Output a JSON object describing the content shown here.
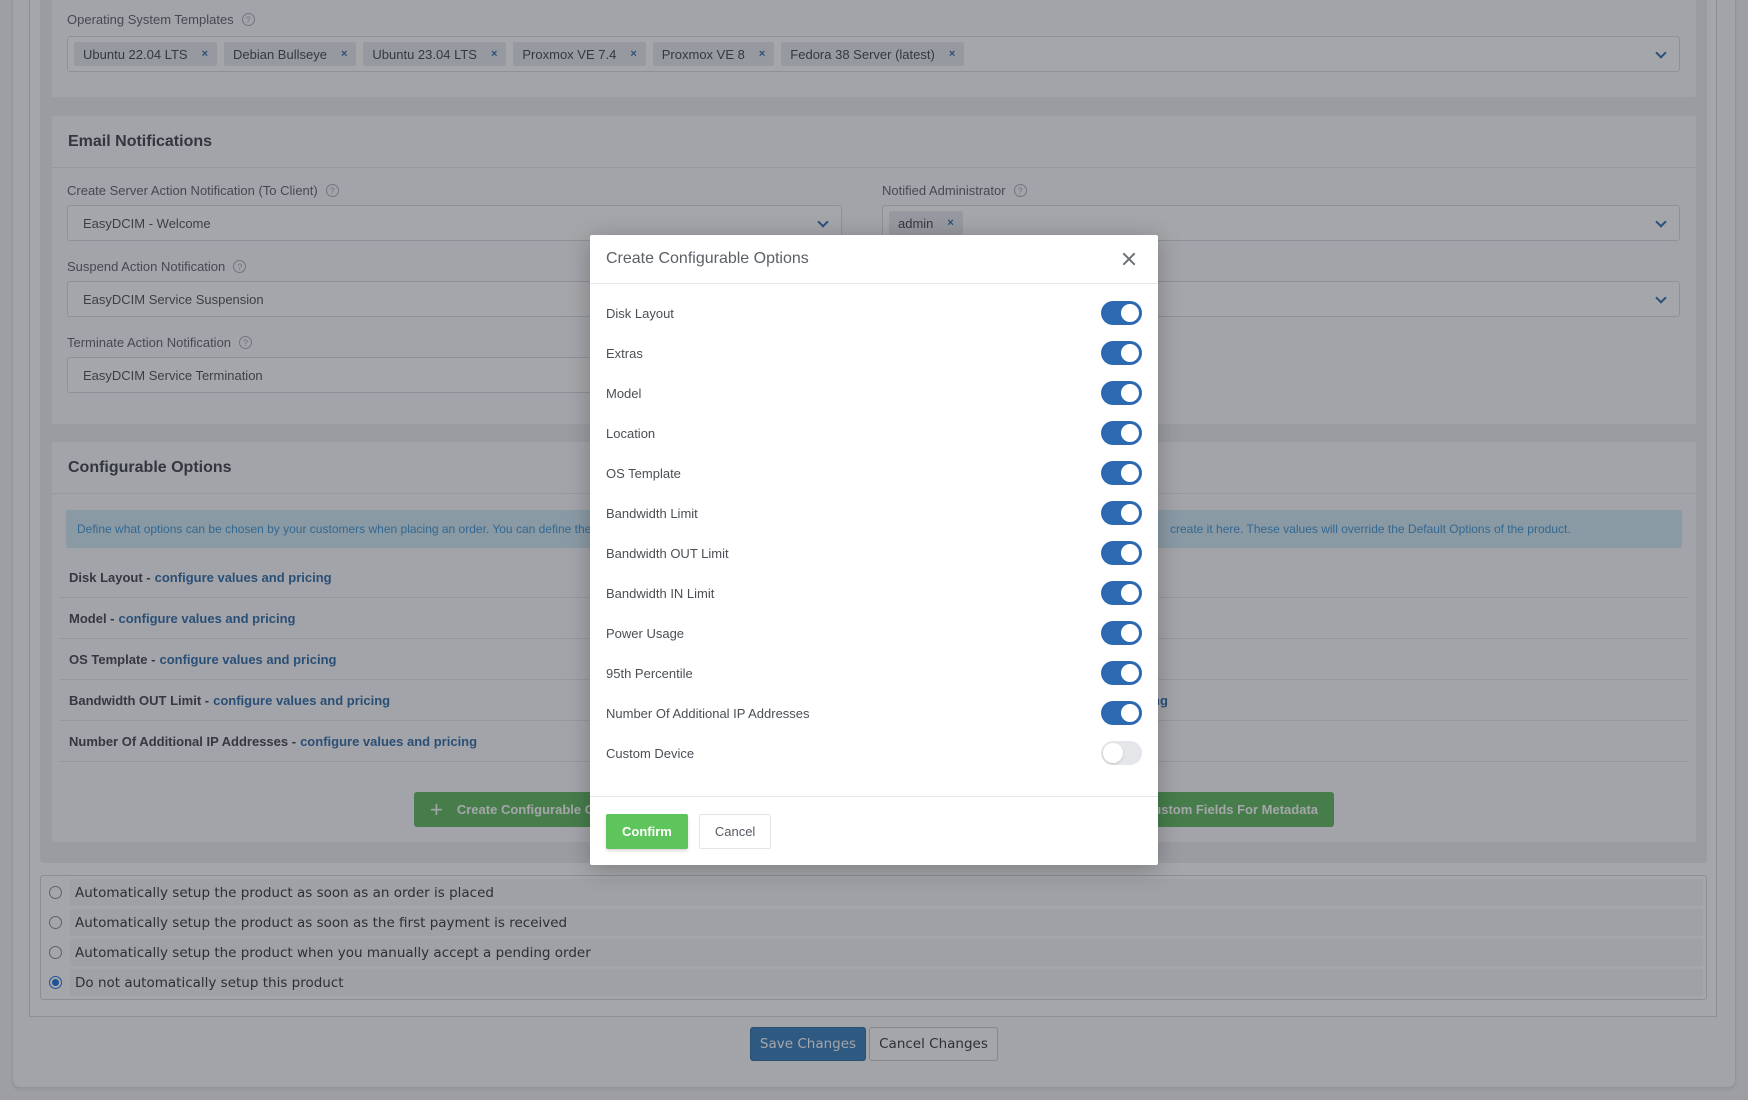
{
  "os_templates": {
    "label": "Operating System Templates",
    "tags": [
      "Ubuntu 22.04 LTS",
      "Debian Bullseye",
      "Ubuntu 23.04 LTS",
      "Proxmox VE 7.4",
      "Proxmox VE 8",
      "Fedora 38 Server (latest)"
    ]
  },
  "email_notifications": {
    "title": "Email Notifications",
    "create_label": "Create Server Action Notification (To Client)",
    "create_value": "EasyDCIM - Welcome",
    "suspend_label": "Suspend Action Notification",
    "suspend_value": "EasyDCIM Service Suspension",
    "terminate_label": "Terminate Action Notification",
    "terminate_value": "EasyDCIM Service Termination",
    "admin_label": "Notified Administrator",
    "admin_tags": [
      "admin"
    ]
  },
  "configurable_options": {
    "title": "Configurable Options",
    "info": "Define what options can be chosen by your customers when placing an order. You can define the",
    "info_tail": "create it here. These values will override the Default Options of the product.",
    "link_text": "configure values and pricing",
    "items": [
      "Disk Layout",
      "Model",
      "OS Template",
      "Bandwidth OUT Limit",
      "Number Of Additional IP Addresses"
    ],
    "right_partial": "ng",
    "create_button": "Create Configurable Options",
    "metadata_button": "Create Custom Fields For Metadata"
  },
  "setup": {
    "options": [
      {
        "label": "Automatically setup the product as soon as an order is placed",
        "checked": false
      },
      {
        "label": "Automatically setup the product as soon as the first payment is received",
        "checked": false
      },
      {
        "label": "Automatically setup the product when you manually accept a pending order",
        "checked": false
      },
      {
        "label": "Do not automatically setup this product",
        "checked": true
      }
    ]
  },
  "actions": {
    "save": "Save Changes",
    "cancel": "Cancel Changes"
  },
  "modal": {
    "title": "Create Configurable Options",
    "options": [
      {
        "label": "Disk Layout",
        "enabled": true
      },
      {
        "label": "Extras",
        "enabled": true
      },
      {
        "label": "Model",
        "enabled": true
      },
      {
        "label": "Location",
        "enabled": true
      },
      {
        "label": "OS Template",
        "enabled": true
      },
      {
        "label": "Bandwidth Limit",
        "enabled": true
      },
      {
        "label": "Bandwidth OUT Limit",
        "enabled": true
      },
      {
        "label": "Bandwidth IN Limit",
        "enabled": true
      },
      {
        "label": "Power Usage",
        "enabled": true
      },
      {
        "label": "95th Percentile",
        "enabled": true
      },
      {
        "label": "Number Of Additional IP Addresses",
        "enabled": true
      },
      {
        "label": "Custom Device",
        "enabled": false
      }
    ],
    "confirm": "Confirm",
    "cancel": "Cancel"
  },
  "colors": {
    "primary": "#2d69b0",
    "success": "#5ec55c",
    "info_bg": "#d1ebf6"
  }
}
